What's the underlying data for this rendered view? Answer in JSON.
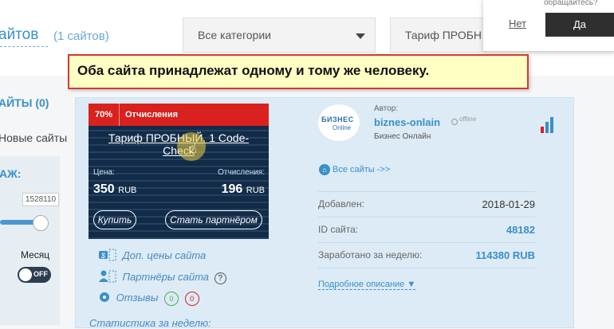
{
  "header": {
    "title_fragment": "айтов",
    "site_count": "(1 сайтов)",
    "category_select": "Все категории",
    "tariff_select": "Тариф ПРОБН"
  },
  "confirm_dialog": {
    "text_fragment": "обращайтесь?",
    "no": "Нет",
    "yes": "Да"
  },
  "annotation": "Оба сайта принадлежат одному и тому же человеку.",
  "sidebar": {
    "sites": "АЙТЫ (0)",
    "new_sites": "Новые сайты",
    "filter_label": "АЖ:",
    "slider_value": "1528110",
    "slider_level_pct": 65,
    "month": "Месяц",
    "toggle": "OFF"
  },
  "product": {
    "percent": "70%",
    "ribbon_label": "Отчисления",
    "title": "Тариф ПРОБНЫЙ. 1 Code-Check",
    "price_label": "Цена:",
    "price": "350",
    "price_currency": "RUB",
    "commission_label": "Отчисления:",
    "commission": "196",
    "commission_currency": "RUB",
    "buy": "Купить",
    "partner": "Стать партнёром"
  },
  "links": {
    "extra_prices": "Доп. цены сайта",
    "partners": "Партнёры сайта",
    "partners_help": "?",
    "reviews": "Отзывы",
    "reviews_positive": "0",
    "reviews_negative": "0",
    "stats": "Статистика за неделю:"
  },
  "author": {
    "label": "Автор:",
    "name": "biznes-onlain",
    "status": "offline",
    "subtitle": "Бизнес Онлайн",
    "logo_top": "БИЗНЕС",
    "logo_bottom": "Online"
  },
  "details": {
    "all_sites": "Все сайты ->>",
    "added_label": "Добавлен:",
    "added_value": "2018-01-29",
    "id_label": "ID сайта:",
    "id_value": "48182",
    "earned_label": "Заработано за неделю:",
    "earned_value": "114380 RUB",
    "description_link": "Подробное описание ▼"
  }
}
